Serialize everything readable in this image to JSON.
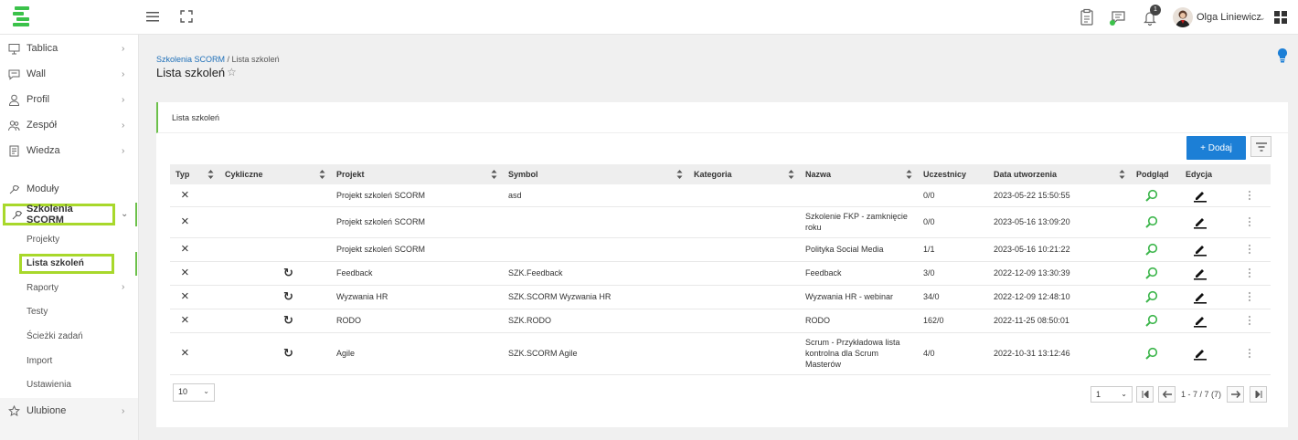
{
  "header": {
    "notifications_count": "1",
    "user_name": "Olga Liniewicz",
    "user_chevron": "⌄"
  },
  "sidebar": {
    "items": [
      {
        "label": "Tablica",
        "icon": "monitor-icon",
        "chevron": "›"
      },
      {
        "label": "Wall",
        "icon": "chat-icon",
        "chevron": "›"
      },
      {
        "label": "Profil",
        "icon": "user-icon",
        "chevron": "›"
      },
      {
        "label": "Zespół",
        "icon": "team-icon",
        "chevron": "›"
      },
      {
        "label": "Wiedza",
        "icon": "book-icon",
        "chevron": "›"
      },
      {
        "label": "Moduły",
        "icon": "wrench-icon"
      },
      {
        "label": "Szkolenia SCORM",
        "icon": "wrench-icon",
        "chevron": "⌄"
      },
      {
        "label": "Ulubione",
        "icon": "star-icon",
        "chevron": "›"
      }
    ],
    "subitems": [
      {
        "label": "Projekty"
      },
      {
        "label": "Lista szkoleń"
      },
      {
        "label": "Raporty",
        "chevron": "›"
      },
      {
        "label": "Testy"
      },
      {
        "label": "Ścieżki zadań"
      },
      {
        "label": "Import"
      },
      {
        "label": "Ustawienia"
      }
    ]
  },
  "breadcrumb": {
    "link": "Szkolenia SCORM",
    "separator": " / ",
    "current": "Lista szkoleń"
  },
  "page": {
    "title": "Lista szkoleń",
    "star": "☆"
  },
  "card": {
    "title": "Lista szkoleń",
    "add_label": "+ Dodaj"
  },
  "table": {
    "columns": [
      "Typ",
      "Cykliczne",
      "Projekt",
      "Symbol",
      "Kategoria",
      "Nazwa",
      "Uczestnicy",
      "Data utworzenia",
      "Podgląd",
      "Edycja"
    ],
    "rows": [
      {
        "typ": "×",
        "cykliczne": "",
        "projekt": "Projekt szkoleń SCORM",
        "symbol": "asd",
        "kategoria": "",
        "nazwa": "",
        "uczestnicy": "0/0",
        "data": "2023-05-22 15:50:55"
      },
      {
        "typ": "×",
        "cykliczne": "",
        "projekt": "Projekt szkoleń SCORM",
        "symbol": "",
        "kategoria": "",
        "nazwa": "Szkolenie FKP - zamknięcie roku",
        "uczestnicy": "0/0",
        "data": "2023-05-16 13:09:20"
      },
      {
        "typ": "×",
        "cykliczne": "",
        "projekt": "Projekt szkoleń SCORM",
        "symbol": "",
        "kategoria": "",
        "nazwa": "Polityka Social Media",
        "uczestnicy": "1/1",
        "data": "2023-05-16 10:21:22"
      },
      {
        "typ": "×",
        "cykliczne": "↻",
        "projekt": "Feedback",
        "symbol": "SZK.Feedback",
        "kategoria": "",
        "nazwa": "Feedback",
        "uczestnicy": "3/0",
        "data": "2022-12-09 13:30:39"
      },
      {
        "typ": "×",
        "cykliczne": "↻",
        "projekt": "Wyzwania HR",
        "symbol": "SZK.SCORM Wyzwania HR",
        "kategoria": "",
        "nazwa": "Wyzwania HR - webinar",
        "uczestnicy": "34/0",
        "data": "2022-12-09 12:48:10"
      },
      {
        "typ": "×",
        "cykliczne": "↻",
        "projekt": "RODO",
        "symbol": "SZK.RODO",
        "kategoria": "",
        "nazwa": "RODO",
        "uczestnicy": "162/0",
        "data": "2022-11-25 08:50:01"
      },
      {
        "typ": "×",
        "cykliczne": "↻",
        "projekt": "Agile",
        "symbol": "SZK.SCORM Agile",
        "kategoria": "",
        "nazwa": "Scrum - Przykładowa lista kontrolna dla Scrum Masterów",
        "uczestnicy": "4/0",
        "data": "2022-10-31 13:12:46"
      }
    ]
  },
  "pagination": {
    "page_size": "10",
    "page": "1",
    "caret": "⌄",
    "info": "1 - 7 / 7 (7)"
  },
  "colors": {
    "accent_green": "#6cc04a",
    "highlight_lime": "#a8d82b",
    "primary_blue": "#1c7fd6"
  }
}
